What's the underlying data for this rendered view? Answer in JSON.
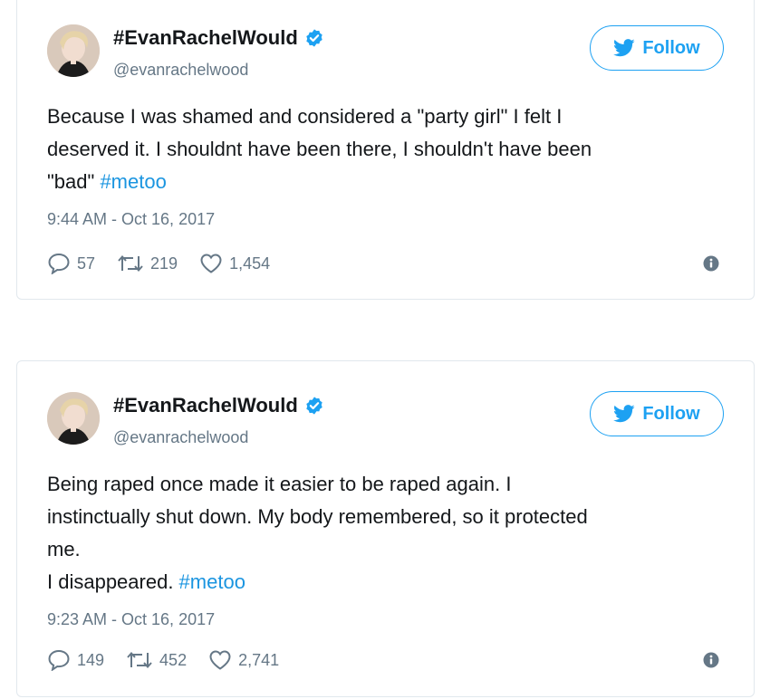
{
  "tweets": [
    {
      "display_name": "#EvanRachelWould",
      "handle": "@evanrachelwood",
      "follow_label": "Follow",
      "text_lines": [
        "Because I was shamed and considered a \"party girl\" I felt I",
        "deserved it. I shouldnt have been there, I shouldn't have been",
        "\"bad\" "
      ],
      "hashtag": "#metoo",
      "timestamp": "9:44 AM - Oct 16, 2017",
      "replies": "57",
      "retweets": "219",
      "likes": "1,454"
    },
    {
      "display_name": "#EvanRachelWould",
      "handle": "@evanrachelwood",
      "follow_label": "Follow",
      "text_lines": [
        "Being raped once made it easier to be raped again. I",
        "instinctually shut down. My body remembered, so it protected",
        "me.",
        "I disappeared. "
      ],
      "hashtag": "#metoo",
      "timestamp": "9:23 AM - Oct 16, 2017",
      "replies": "149",
      "retweets": "452",
      "likes": "2,741"
    }
  ],
  "colors": {
    "accent": "#1da1f2",
    "hashtag": "#1b95e0",
    "muted": "#657786",
    "border": "#e1e8ed"
  },
  "icons": [
    "verified-badge-icon",
    "twitter-bird-icon",
    "reply-icon",
    "retweet-icon",
    "like-icon",
    "info-icon"
  ]
}
